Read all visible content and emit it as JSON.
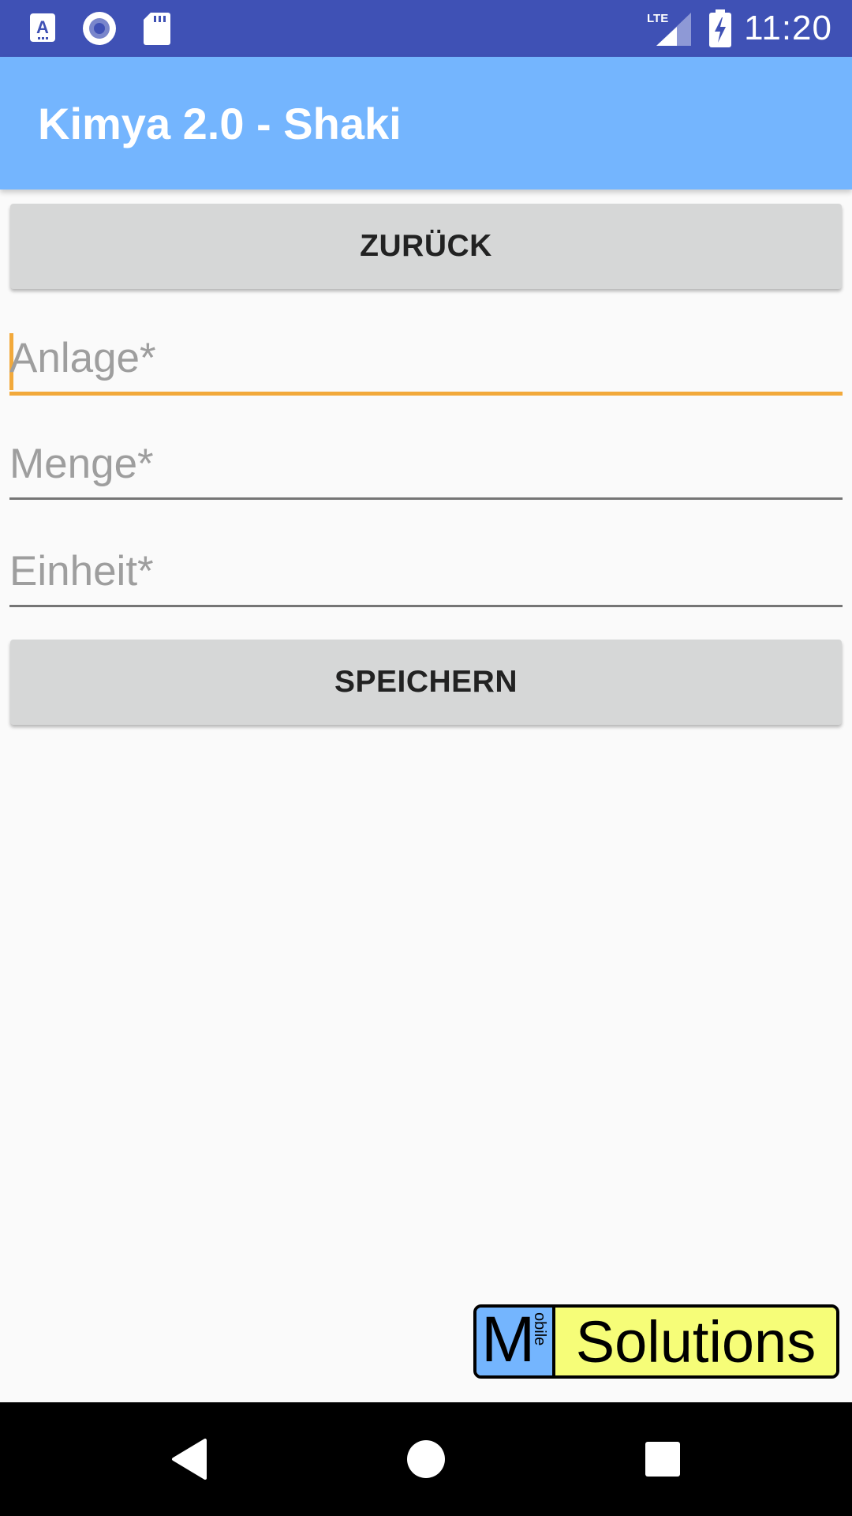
{
  "status_bar": {
    "time": "11:20",
    "icons": [
      "font-notification-icon",
      "record-notification-icon",
      "sd-card-icon",
      "lte-signal-icon",
      "battery-charging-icon"
    ],
    "network_label": "LTE",
    "background_color": "#3f51b5"
  },
  "app_bar": {
    "title": "Kimya 2.0 - Shaki",
    "background_color": "#74b5fe"
  },
  "buttons": {
    "back_label": "ZURÜCK",
    "save_label": "SPEICHERN"
  },
  "form": {
    "anlage": {
      "placeholder": "Anlage*",
      "value": ""
    },
    "menge": {
      "placeholder": "Menge*",
      "value": ""
    },
    "einheit": {
      "placeholder": "Einheit*",
      "value": ""
    },
    "focus_color": "#f2a93b"
  },
  "logo": {
    "letter": "M",
    "vertical_text": "obile",
    "word": "Solutions",
    "left_color": "#74b5fe",
    "right_color": "#f6fd78"
  },
  "nav_bar": {
    "icons": [
      "back-triangle-icon",
      "home-circle-icon",
      "recents-square-icon"
    ]
  }
}
